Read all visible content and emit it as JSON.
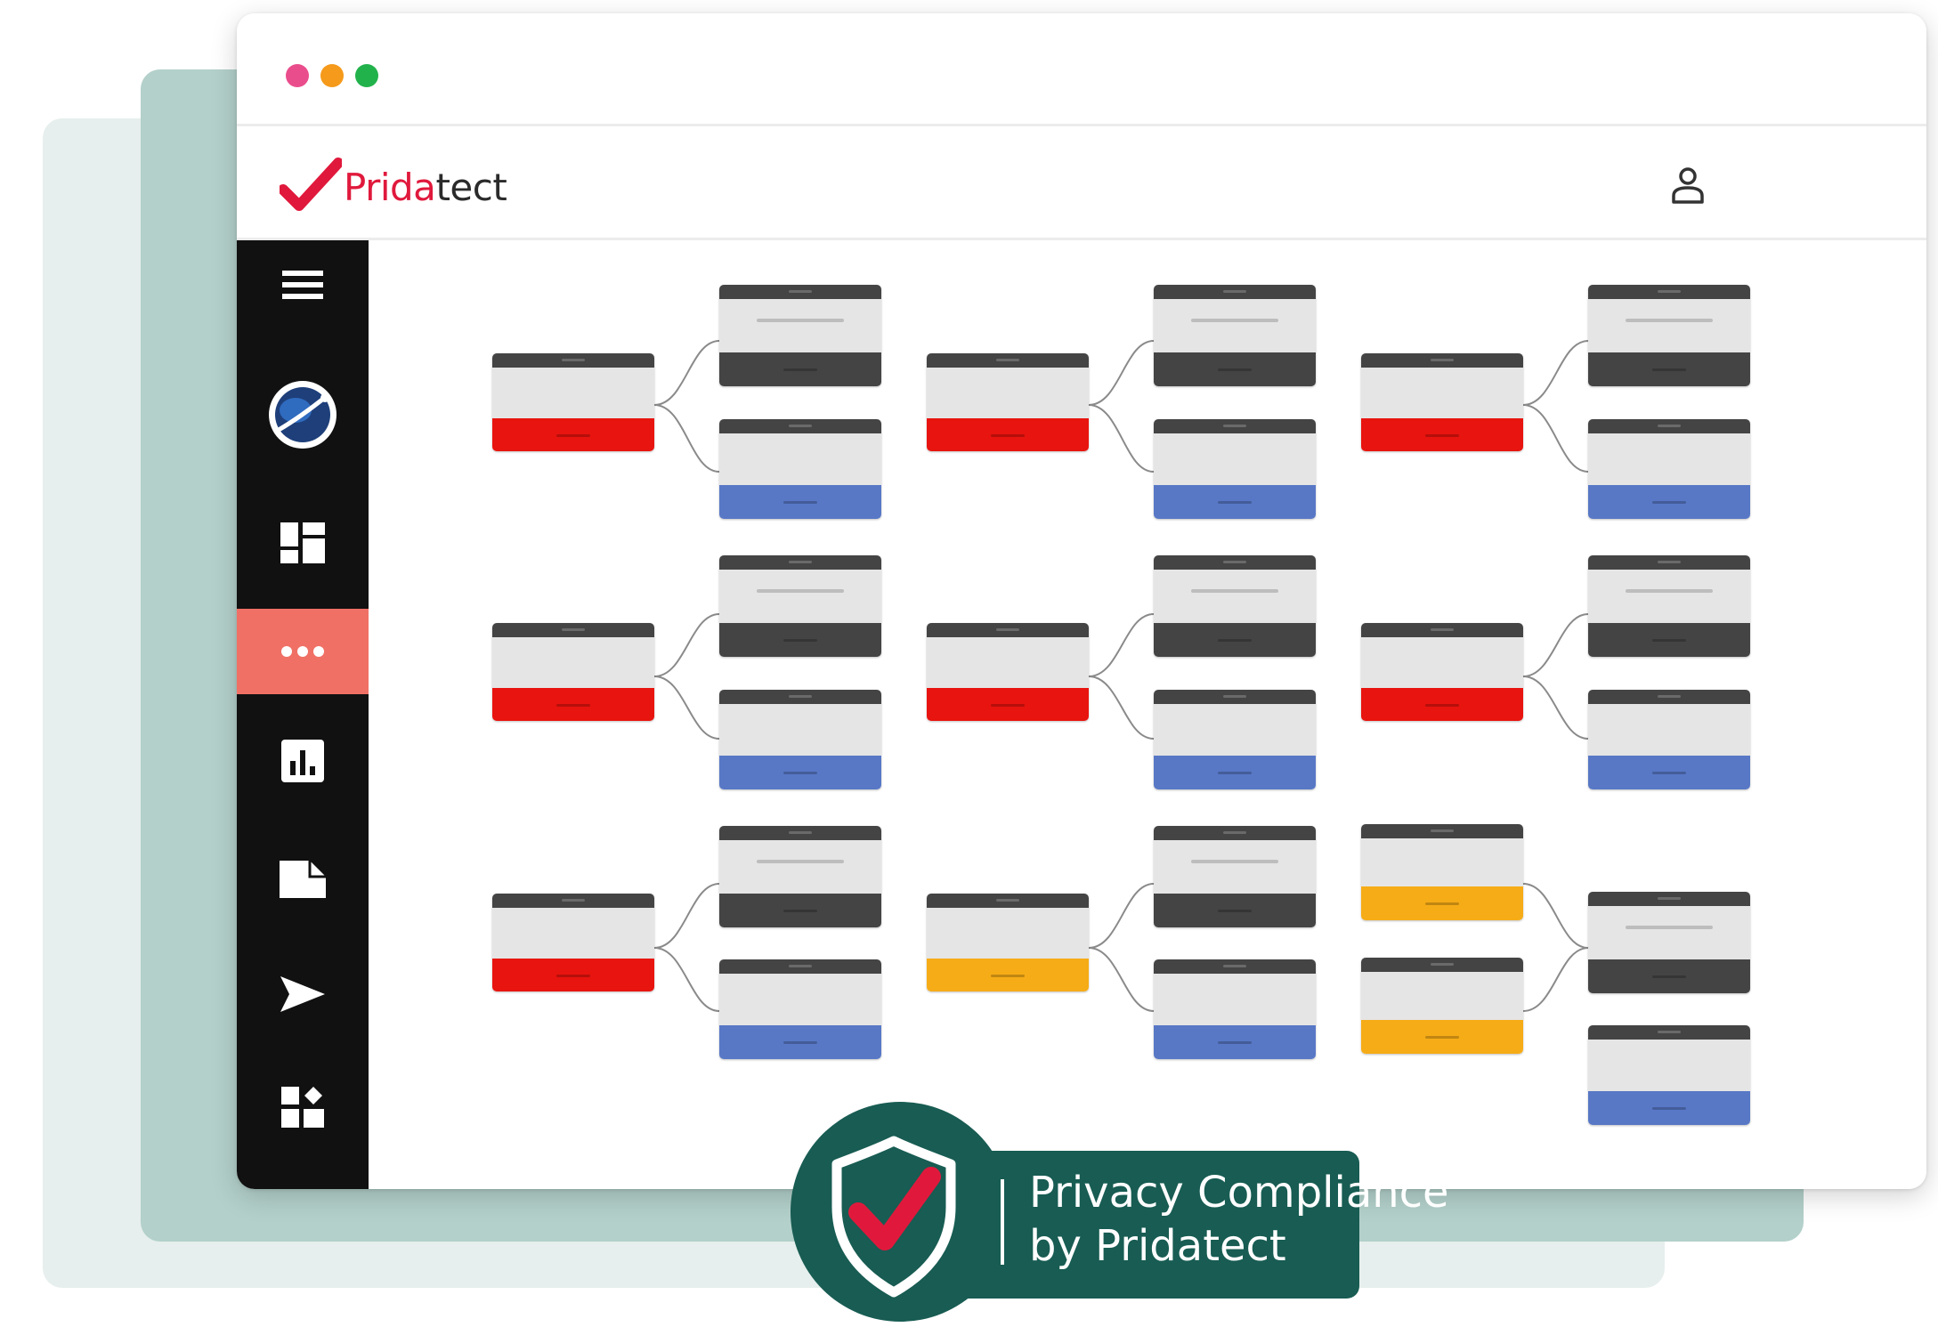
{
  "brand": {
    "logo_part1": "Prida",
    "logo_part2": "tect",
    "accent_color": "#e0193c"
  },
  "window": {
    "traffic_lights": [
      "#ea4d8c",
      "#f59a1b",
      "#22b24c"
    ]
  },
  "header": {
    "user_icon": "user-icon"
  },
  "sidebar": {
    "items": [
      {
        "icon": "menu-icon",
        "active": false
      },
      {
        "icon": "globe-icon",
        "active": false
      },
      {
        "icon": "dashboard-icon",
        "active": false
      },
      {
        "icon": "more-dots-icon",
        "active": true
      },
      {
        "icon": "bar-chart-icon",
        "active": false
      },
      {
        "icon": "document-icon",
        "active": false
      },
      {
        "icon": "send-icon",
        "active": false
      },
      {
        "icon": "widgets-icon",
        "active": false
      }
    ],
    "active_color": "#f07065"
  },
  "flow_canvas": {
    "status_colors": {
      "red": "#e8140f",
      "blue": "#5878c6",
      "dark": "#444444",
      "amber": "#f6ac17"
    }
  },
  "badge": {
    "line1": "Privacy Compliance",
    "line2": "by Pridatect",
    "color": "#185c53"
  }
}
